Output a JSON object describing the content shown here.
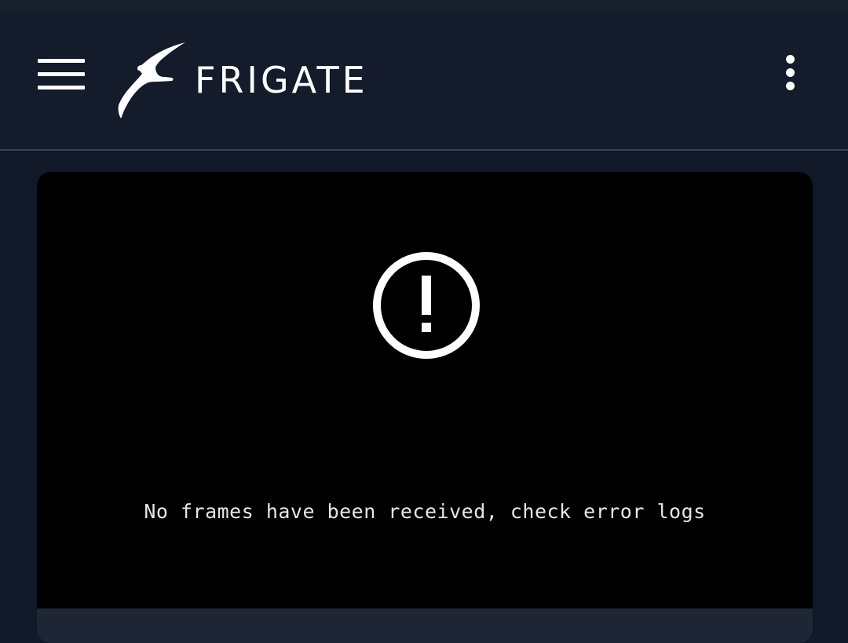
{
  "header": {
    "brand": "FRIGATE",
    "menu_icon": "hamburger-menu-icon",
    "logo_icon": "frigate-bird-logo",
    "more_icon": "more-vert-icon"
  },
  "camera": {
    "status_icon": "alert-circle-icon",
    "error_message": "No frames have been received, check error logs"
  },
  "colors": {
    "background": "#111827",
    "app_bar": "#141b2a",
    "camera_view": "#000000",
    "card_footer": "#1e2636",
    "foreground": "#ffffff"
  }
}
